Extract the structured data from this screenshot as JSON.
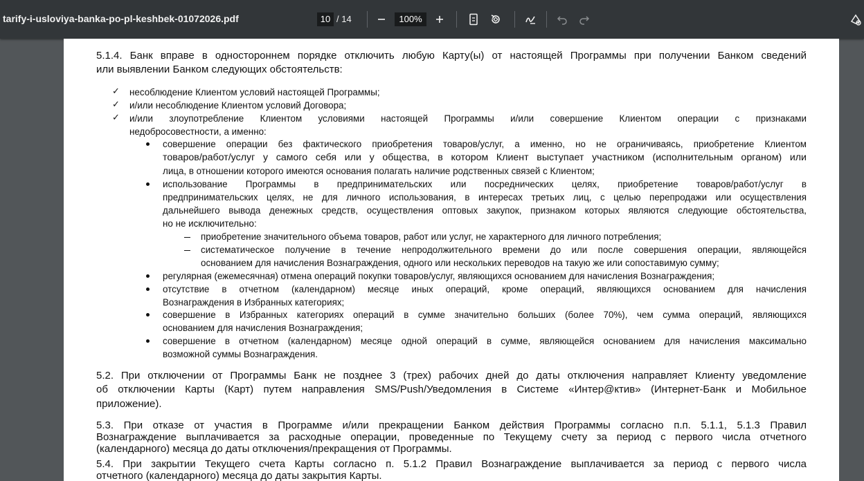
{
  "toolbar": {
    "filename": "tarify-i-usloviya-banka-po-pl-keshbek-01072026.pdf",
    "current_page": "10",
    "page_separator": "/ 14",
    "zoom": "100%"
  },
  "icons": {
    "zoom_out": "minus-icon",
    "zoom_in": "plus-icon",
    "fit": "fit-page-icon",
    "rotate": "rotate-icon",
    "draw": "draw-icon",
    "undo": "undo-icon",
    "redo": "redo-icon",
    "annotate": "annotate-icon"
  },
  "doc": {
    "p514_l1": "5.1.4. Банк вправе в одностороннем порядке отключить любую Карту(ы) от настоящей Программы при получении Банком сведений",
    "p514_l2": "или выявлении Банком следующих обстоятельств:",
    "c1": "несоблюдение Клиентом условий настоящей Программы;",
    "c2": "и/или несоблюдение Клиентом условий Договора;",
    "c3_l1": "и/или злоупотребление Клиентом условиями настоящей Программы и/или совершение Клиентом операции с признаками",
    "c3_l2": "недобросовестности, а именно:",
    "b1_l1": "совершение операции без фактического приобретения товаров/услуг, а именно, но не ограничиваясь, приобретение Клиентом",
    "b1_l2": "товаров/работ/услуг у самого себя или у общества, в котором Клиент выступает участником (исполнительным органом) или",
    "b1_l3": "лица, в отношении которого имеются основания полагать наличие родственных связей с Клиентом;",
    "b2_l1": "использование Программы в предпринимательских или посреднических целях, приобретение товаров/работ/услуг в",
    "b2_l2": "предпринимательских целях, не для личного использования, в интересах третьих лиц, с целью перепродажи или осуществления",
    "b2_l3": "дальнейшего вывода денежных средств, осуществления оптовых закупок, признаком которых являются следующие обстоятельства,",
    "b2_l4": "но не исключительно:",
    "d1": "приобретение значительного объема товаров, работ или услуг, не характерного для личного потребления;",
    "d2_l1": "систематическое получение в течение непродолжительного времени до или после совершения операции, являющейся",
    "d2_l2": "основанием для начисления Вознаграждения, одного или нескольких переводов на такую же или сопоставимую сумму;",
    "b3": "регулярная (ежемесячная) отмена операций покупки товаров/услуг, являющихся основанием для начисления Вознаграждения;",
    "b4_l1": "отсутствие в отчетном (календарном) месяце иных операций, кроме операций, являющихся основанием для начисления",
    "b4_l2": "Вознаграждения в Избранных категориях;",
    "b5_l1": "совершение в Избранных категориях операций в сумме значительно больших (более 70%), чем сумма операций, являющихся",
    "b5_l2": "основанием для начисления Вознаграждения;",
    "b6_l1": "совершение в отчетном (календарном) месяце одной операций в сумме, являющейся основанием для начисления максимально",
    "b6_l2": "возможной суммы Вознаграждения.",
    "p52_l1": "5.2.  При отключении от Программы Банк не позднее 3 (трех) рабочих дней до даты отключения направляет Клиенту уведомление",
    "p52_l2": "об отключении Карты (Карт) путем направления SMS/Push/Уведомления в Системе «Интер@ктив» (Интернет-Банк и Мобильное",
    "p52_l3": "приложение).",
    "p53_l1": "5.3. При отказе от участия в Программе и/или прекращении Банком действия Программы согласно п.п. 5.1.1, 5.1.3 Правил",
    "p53_l2": "Вознаграждение выплачивается за расходные операции, проведенные по Текущему счету за период с первого числа отчетного",
    "p53_l3": "(календарного) месяца до даты отключения/прекращения от Программы.",
    "p54_l1": "5.4. При закрытии Текущего счета Карты согласно п. 5.1.2 Правил Вознаграждение выплачивается за период с первого числа",
    "p54_l2": "отчетного (календарного) месяца до даты закрытия Карты."
  }
}
